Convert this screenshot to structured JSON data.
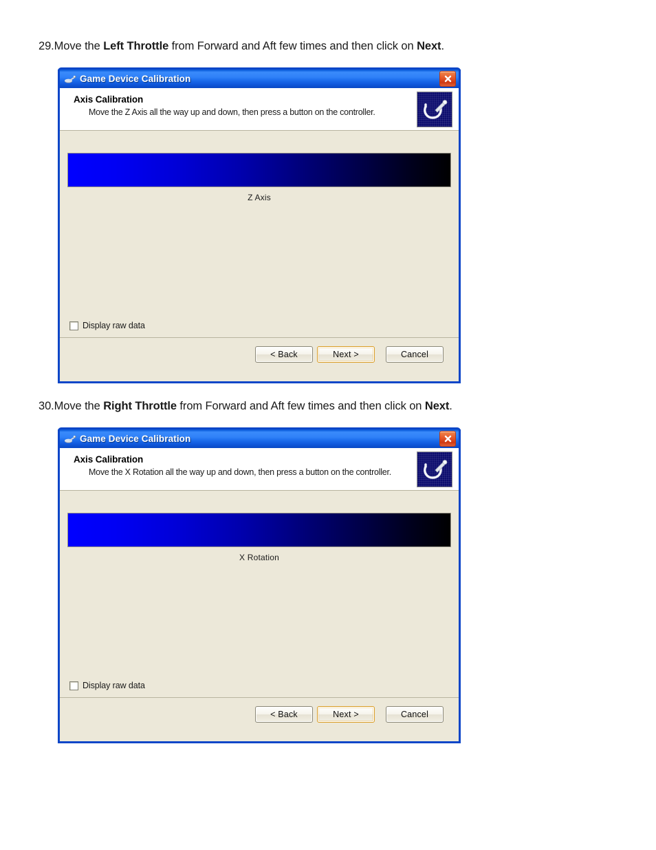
{
  "document": {
    "steps": [
      {
        "number": "29.",
        "pre": "Move the ",
        "bold1": "Left Throttle",
        "mid": " from Forward and Aft few times and then click on ",
        "bold2": "Next",
        "post": "."
      },
      {
        "number": "30.",
        "pre": "Move the ",
        "bold1": "Right Throttle",
        "mid": " from Forward and Aft few times and then click on ",
        "bold2": "Next",
        "post": "."
      }
    ]
  },
  "dialogs": [
    {
      "titlebar": {
        "title": "Game Device Calibration",
        "icon": "joystick-icon",
        "close_label": "Close"
      },
      "header": {
        "title": "Axis Calibration",
        "instruction": "Move the Z Axis all the way up and down, then press a button on the controller.",
        "icon": "joystick-icon"
      },
      "body": {
        "axis_label": "Z Axis",
        "gradient_from": "#0000ff",
        "gradient_to": "#000000",
        "checkbox_label": "Display raw data",
        "checkbox_checked": false
      },
      "footer": {
        "back_label": "< Back",
        "next_label": "Next >",
        "cancel_label": "Cancel",
        "default_button": "Next >"
      }
    },
    {
      "titlebar": {
        "title": "Game Device Calibration",
        "icon": "joystick-icon",
        "close_label": "Close"
      },
      "header": {
        "title": "Axis Calibration",
        "instruction": "Move the X Rotation all the way up and down, then press a button on the controller.",
        "icon": "joystick-icon"
      },
      "body": {
        "axis_label": "X Rotation",
        "gradient_from": "#0000ff",
        "gradient_to": "#000000",
        "checkbox_label": "Display raw data",
        "checkbox_checked": false
      },
      "footer": {
        "back_label": "< Back",
        "next_label": "Next >",
        "cancel_label": "Cancel",
        "default_button": "Next >"
      }
    }
  ],
  "colors": {
    "titlebar_blue": "#1466e2",
    "frame_blue": "#0c46c8",
    "panel_beige": "#ece8d9",
    "close_red": "#e4572a",
    "default_button_gold": "#d99b22",
    "header_icon_navy": "#0d0d6e"
  }
}
